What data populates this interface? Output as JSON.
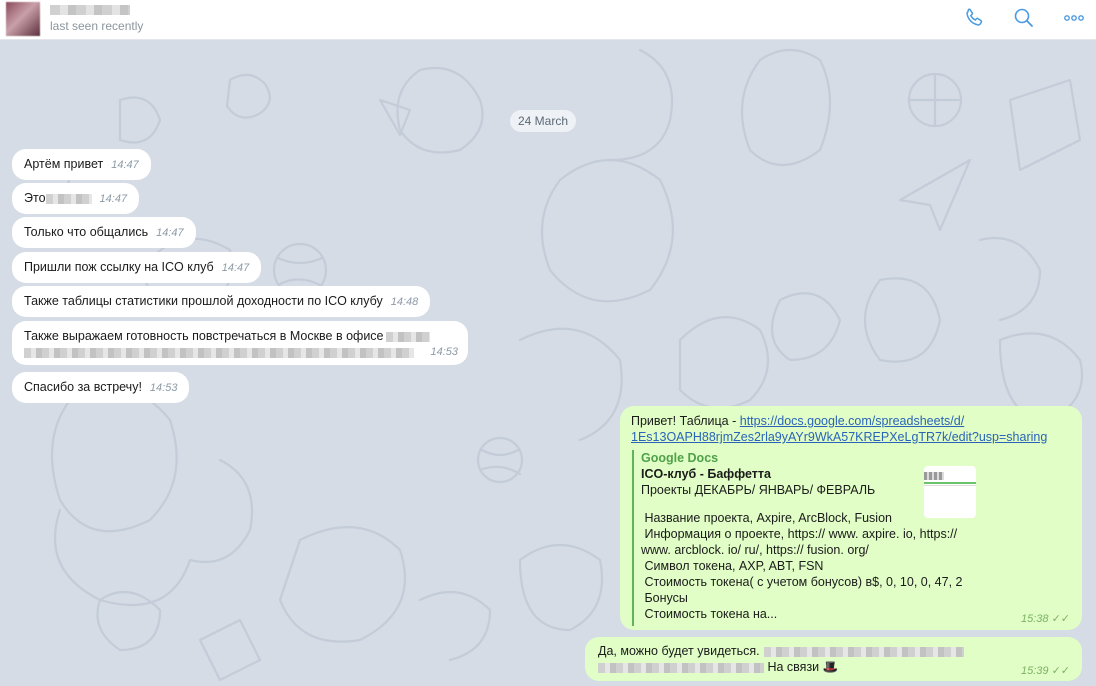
{
  "header": {
    "status": "last seen recently",
    "icons": [
      "phone-icon",
      "search-icon",
      "more-icon"
    ]
  },
  "chat": {
    "date_separator": "24 March",
    "incoming": [
      {
        "text": "Артём привет",
        "time": "14:47"
      },
      {
        "text": "Это",
        "time": "14:47"
      },
      {
        "text": "Только что общались",
        "time": "14:47"
      },
      {
        "text": "Пришли пож ссылку на ICO клуб",
        "time": "14:47"
      },
      {
        "text": "Также таблицы статистики прошлой доходности по ICO клубу",
        "time": "14:48"
      },
      {
        "text": "Также выражаем готовность повстречаться в Москве в офисе",
        "time": "14:53"
      },
      {
        "text": "Спасибо за встречу!",
        "time": "14:53"
      }
    ],
    "outgoing": [
      {
        "text": "Привет! Таблица - ",
        "link_line1": "https://docs.google.com/spreadsheets/d/",
        "link_line2": "1Es13OAPH88rjmZes2rla9yAYr9WkA57KREPXeLgTR7k/edit?usp=sharing",
        "preview": {
          "site": "Google Docs",
          "title": "ICO-клуб - Баффетта",
          "subtitle": "Проекты ДЕКАБРЬ/ ЯНВАРЬ/ ФЕВРАЛЬ",
          "lines": [
            " Название проекта, Axpire, ArcBlock, Fusion",
            " Информация о проекте, https:// www. axpire. io, https://",
            "www. arcblock. io/ ru/, https:// fusion. org/",
            " Символ токена, AXP, ABT, FSN",
            " Стоимость токена( с учетом бонусов) в$, 0, 10, 0, 47, 2",
            " Бонусы",
            " Стоимость токена на..."
          ]
        },
        "time": "15:38"
      },
      {
        "text_line1": "Да, можно будет увидеться.",
        "text_line2": "На связи",
        "emoji": "🎩",
        "time": "15:39"
      }
    ]
  },
  "colors": {
    "incoming_bg": "#ffffff",
    "outgoing_bg": "#e1fec6",
    "link": "#2a64b8",
    "preview_accent": "#5fb55a",
    "header_icon": "#4a9be0"
  }
}
